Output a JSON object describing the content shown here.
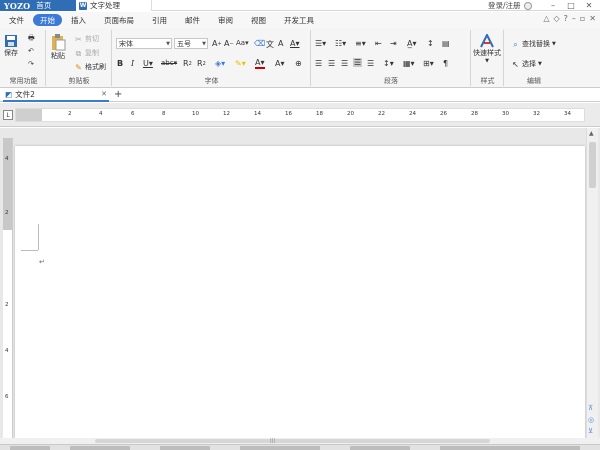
{
  "titlebar": {
    "logo": "YOZO",
    "home_label": "首页",
    "doc_icon": "W",
    "doc_tab_label": "文字处理",
    "login_label": "登录/注册",
    "minimize": "–",
    "restore": "□",
    "close": "✕"
  },
  "menu": {
    "items": [
      "文件",
      "开始",
      "插入",
      "页面布局",
      "引用",
      "邮件",
      "审阅",
      "视图",
      "开发工具"
    ],
    "active": "开始"
  },
  "ribbon": {
    "common": {
      "save_label": "保存",
      "group_label": "常用功能"
    },
    "clipboard": {
      "paste_label": "粘贴",
      "cut_label": "剪切",
      "copy_label": "复制",
      "format_painter_label": "格式刷",
      "group_label": "剪贴板"
    },
    "font": {
      "font_name": "宋体",
      "font_size": "五号",
      "group_label": "字体"
    },
    "paragraph": {
      "group_label": "段落"
    },
    "styles": {
      "quick_styles_label": "快速样式",
      "group_label": "样式"
    },
    "editing": {
      "find_replace_label": "查找替换",
      "select_label": "选择",
      "group_label": "编辑"
    }
  },
  "doc_tabs": {
    "tab_label": "文件2",
    "add_label": "+"
  },
  "ruler": {
    "ticks": [
      "2",
      "4",
      "6",
      "8",
      "10",
      "12",
      "14",
      "16",
      "18",
      "20",
      "22",
      "24",
      "26",
      "28",
      "30",
      "32",
      "34"
    ],
    "vticks": [
      "4",
      "2",
      "2",
      "4",
      "6"
    ]
  },
  "colors": {
    "accent": "#3d7ad6",
    "brand": "#2f6db5"
  }
}
